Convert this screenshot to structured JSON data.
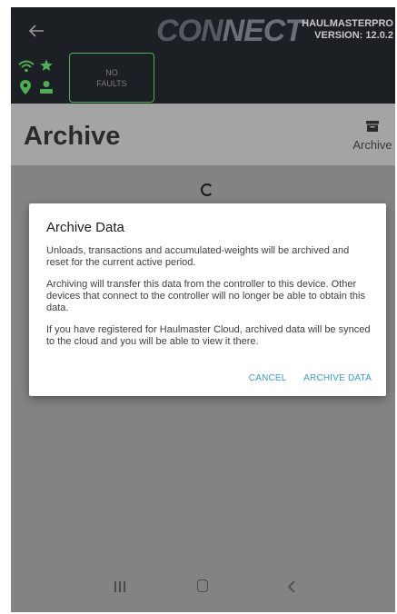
{
  "app": {
    "logo_text_a": "CON",
    "logo_text_b": "NECT",
    "product": "HAULMASTERPRO",
    "version": "VERSION: 12.0.2",
    "status_card": "NO\nFAULTS",
    "icons": [
      "back-arrow-icon",
      "wifi-icon",
      "star-icon",
      "location-pin-icon",
      "person-icon"
    ]
  },
  "page": {
    "title": "Archive",
    "action_label": "Archive",
    "action_icon": "archive-box-icon"
  },
  "dialog": {
    "title": "Archive Data",
    "paragraphs": [
      "Unloads, transactions and accumulated-weights will be archived and reset for the current active period.",
      "Archiving will transfer this data from the controller to this device. Other devices that connect to the controller will no longer be able to obtain this data.",
      "If you have registered for Haulmaster Cloud, archived data will be synced to the cloud and you will be able to view it there."
    ],
    "cancel_label": "CANCEL",
    "confirm_label": "ARCHIVE DATA"
  },
  "colors": {
    "appbar": "#1c2024",
    "accent_green": "#4caf50",
    "link_blue": "#3a9ad8",
    "scrim": "#838383"
  }
}
